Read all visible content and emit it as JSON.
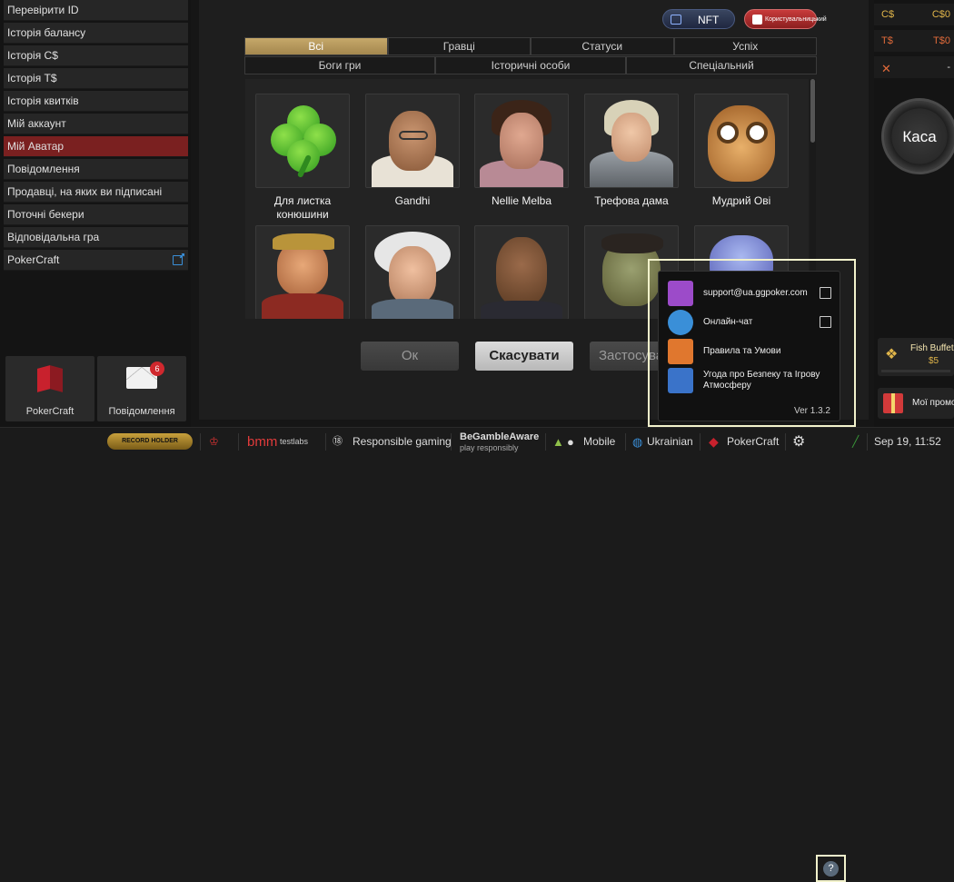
{
  "sidebar": {
    "items": [
      {
        "label": "Перевірити ID"
      },
      {
        "label": "Історія балансу"
      },
      {
        "label": "Історія C$"
      },
      {
        "label": "Історія T$"
      },
      {
        "label": "Історія квитків"
      },
      {
        "label": "Мій аккаунт"
      },
      {
        "label": "Мій Аватар"
      },
      {
        "label": "Повідомлення"
      },
      {
        "label": "Продавці, на яких ви підписані"
      },
      {
        "label": "Поточні бекери"
      },
      {
        "label": "Відповідальна гра"
      },
      {
        "label": "PokerCraft"
      }
    ],
    "active_index": 6,
    "tiles": {
      "pokercraft_label": "PokerCraft",
      "messages_label": "Повідомлення",
      "messages_badge": "6"
    }
  },
  "header": {
    "nft_label": "NFT",
    "user_label": "Користувальницький"
  },
  "tabs_row1": [
    "Всі",
    "Гравці",
    "Статуси",
    "Успіх"
  ],
  "tabs_row2": [
    "Боги гри",
    "Історичні особи",
    "Спеціальний"
  ],
  "avatars": [
    {
      "label": "Для листка конюшини",
      "icon": "clover-icon"
    },
    {
      "label": "Gandhi",
      "icon": "gandhi-portrait"
    },
    {
      "label": "Nellie Melba",
      "icon": "nellie-portrait"
    },
    {
      "label": "Трефова дама",
      "icon": "queen-of-clubs-portrait"
    },
    {
      "label": "Мудрий Ові",
      "icon": "owl-portrait"
    }
  ],
  "actions": {
    "ok": "Ок",
    "cancel": "Скасувати",
    "apply": "Застосувати"
  },
  "help_popup": {
    "items": [
      {
        "label": "support@ua.ggpoker.com",
        "color": "#9c4bc9"
      },
      {
        "label": "Онлайн-чат",
        "color": "#3a8fd8"
      },
      {
        "label": "Правила та Умови",
        "color": "#e0772e"
      },
      {
        "label": "Угода про Безпеку та Ігрову Атмосферу",
        "color": "#3a73c9"
      }
    ],
    "version": "Ver 1.3.2"
  },
  "wallet": {
    "cdollar_label": "C$",
    "cdollar_value": "C$0",
    "tdollar_label": "T$",
    "tdollar_value": "T$0",
    "tickets_value": "-",
    "kassa_label": "Каса",
    "fish_buffet_label": "Fish Buffet",
    "fish_buffet_value": "$5",
    "promo_label": "Мої промо"
  },
  "bottom_bar": {
    "record_holder": "RECORD HOLDER",
    "bmm": "bmm",
    "testlabs": "testlabs",
    "responsible_gaming": "Responsible gaming",
    "gamble_aware": "BeGambleAware",
    "gamble_aware_sub": "play responsibly",
    "mobile": "Mobile",
    "language": "Ukrainian",
    "pokercraft": "PokerCraft",
    "datetime": "Sep 19, 11:52"
  }
}
